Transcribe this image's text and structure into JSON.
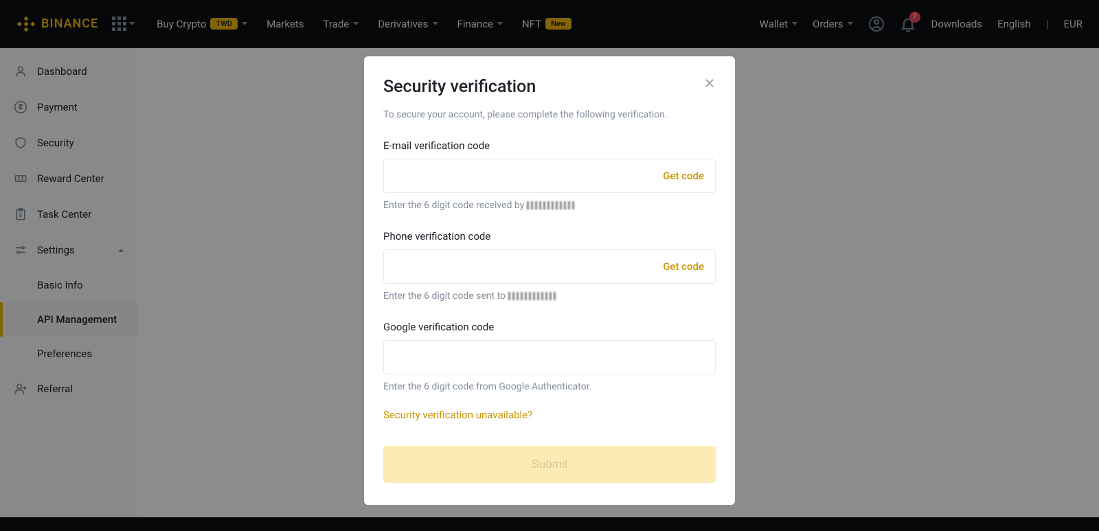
{
  "header": {
    "brand": "BINANCE",
    "nav": {
      "buy_crypto": "Buy Crypto",
      "twd_badge": "TWD",
      "markets": "Markets",
      "trade": "Trade",
      "derivatives": "Derivatives",
      "finance": "Finance",
      "nft": "NFT",
      "new_badge": "New"
    },
    "right": {
      "wallet": "Wallet",
      "orders": "Orders",
      "notif_count": "7",
      "downloads": "Downloads",
      "language": "English",
      "currency": "EUR"
    }
  },
  "sidebar": {
    "dashboard": "Dashboard",
    "payment": "Payment",
    "security": "Security",
    "reward_center": "Reward Center",
    "task_center": "Task Center",
    "settings": "Settings",
    "basic_info": "Basic Info",
    "api_management": "API Management",
    "preferences": "Preferences",
    "referral": "Referral"
  },
  "modal": {
    "title": "Security verification",
    "subtitle": "To secure your account, please complete the following verification.",
    "email_label": "E-mail verification code",
    "email_getcode": "Get code",
    "email_hint": "Enter the 6 digit code received by ",
    "phone_label": "Phone verification code",
    "phone_getcode": "Get code",
    "phone_hint": "Enter the 6 digit code sent to ",
    "google_label": "Google verification code",
    "google_hint": "Enter the 6 digit code from Google Authenticator.",
    "help_link": "Security verification unavailable?",
    "submit": "Submit"
  }
}
